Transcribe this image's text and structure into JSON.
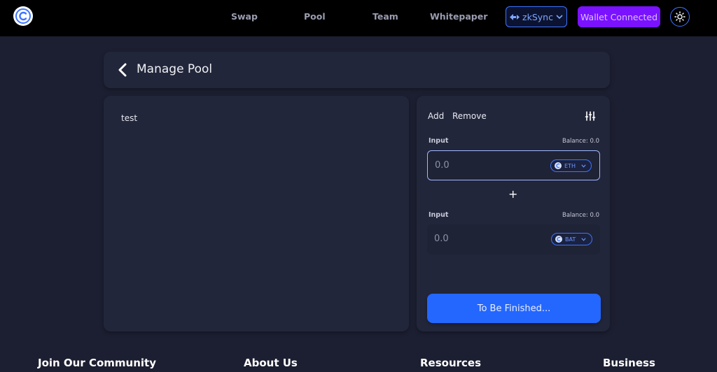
{
  "nav": {
    "links": [
      "Swap",
      "Pool",
      "Team",
      "Whitepaper"
    ],
    "network_label": "zkSync",
    "wallet_label": "Wallet Connected"
  },
  "header": {
    "title": "Manage Pool"
  },
  "left_panel": {
    "text": "test"
  },
  "pool_form": {
    "tabs": [
      "Add",
      "Remove"
    ],
    "inputs": [
      {
        "label": "Input",
        "balance": "Balance: 0.0",
        "placeholder": "0.0",
        "token": "ETH"
      },
      {
        "label": "Input",
        "balance": "Balance: 0.0",
        "placeholder": "0.0",
        "token": "BAT"
      }
    ],
    "plus": "+",
    "submit_label": "To Be Finished..."
  },
  "footer": {
    "headings": [
      "Join Our Community",
      "About Us",
      "Resources",
      "Business"
    ]
  },
  "colors": {
    "accent_blue": "#2467ff",
    "wallet_purple": "#7a12ff",
    "background": "#1c1f31",
    "panel": "#22263a"
  }
}
